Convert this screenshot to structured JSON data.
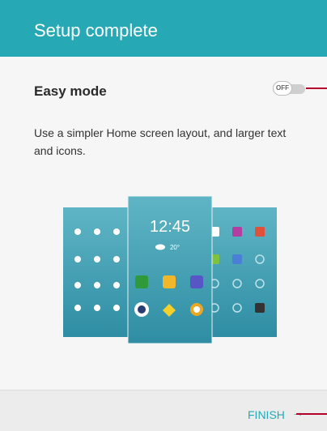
{
  "header": {
    "title": "Setup complete"
  },
  "easy_mode": {
    "label": "Easy mode",
    "toggle_state": "OFF",
    "description": "Use a simpler Home screen layout, and larger text and icons."
  },
  "illustration": {
    "clock": "12:45",
    "weather_temp": "20°"
  },
  "footer": {
    "finish_label": "FINISH"
  },
  "colors": {
    "accent": "#26a9b4",
    "callout": "#b3002a"
  }
}
